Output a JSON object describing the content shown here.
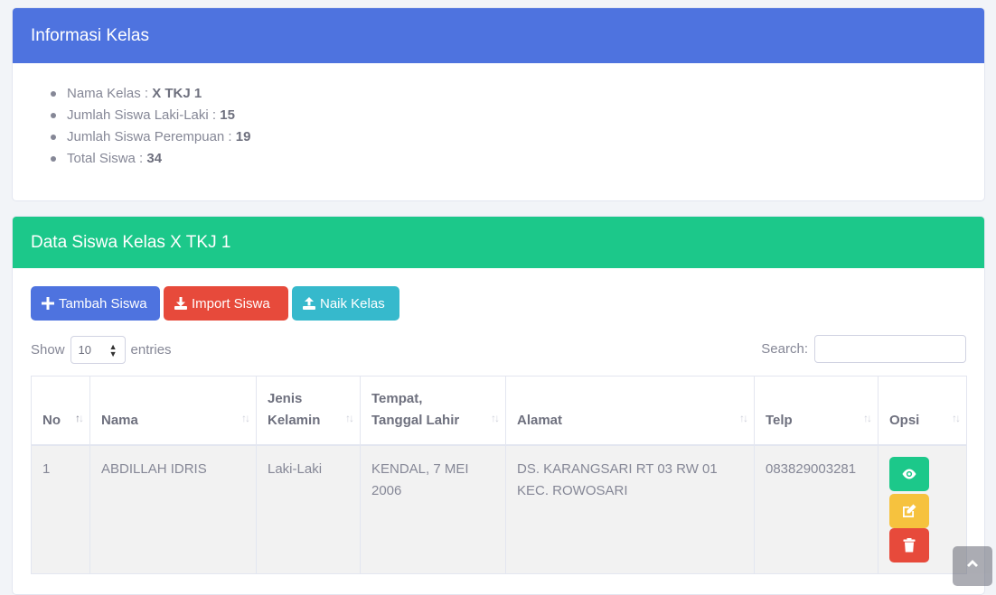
{
  "info": {
    "title": "Informasi Kelas",
    "items": [
      {
        "label": "Nama Kelas : ",
        "value": "X TKJ 1"
      },
      {
        "label": "Jumlah Siswa Laki-Laki : ",
        "value": "15"
      },
      {
        "label": "Jumlah Siswa Perempuan : ",
        "value": "19"
      },
      {
        "label": "Total Siswa : ",
        "value": "34"
      }
    ]
  },
  "data_card": {
    "title": "Data Siswa Kelas X TKJ 1",
    "buttons": {
      "add": "Tambah Siswa",
      "import": "Import Siswa",
      "promote": "Naik Kelas"
    },
    "length": {
      "show": "Show",
      "value": "10",
      "entries": "entries"
    },
    "search_label": "Search:",
    "columns": [
      "No",
      "Nama",
      "Jenis Kelamin",
      "Tempat, Tanggal Lahir",
      "Alamat",
      "Telp",
      "Opsi"
    ],
    "column_lines": {
      "jenis": [
        "Jenis",
        "Kelamin"
      ],
      "ttl": [
        "Tempat,",
        "Tanggal Lahir"
      ]
    },
    "rows": [
      {
        "no": "1",
        "nama": "ABDILLAH IDRIS",
        "jk": "Laki-Laki",
        "ttl": "KENDAL, 7 MEI 2006",
        "alamat": "DS. KARANGSARI RT 03 RW 01 KEC. ROWOSARI",
        "telp": "083829003281"
      }
    ]
  },
  "colors": {
    "primary": "#4e73df",
    "success": "#1cc88a",
    "danger": "#e74a3b",
    "info": "#36b9cc",
    "warning": "#f6c23e"
  },
  "icons": [
    "plus-icon",
    "download-icon",
    "upload-icon",
    "eye-icon",
    "edit-icon",
    "trash-icon",
    "chevron-up-icon"
  ]
}
